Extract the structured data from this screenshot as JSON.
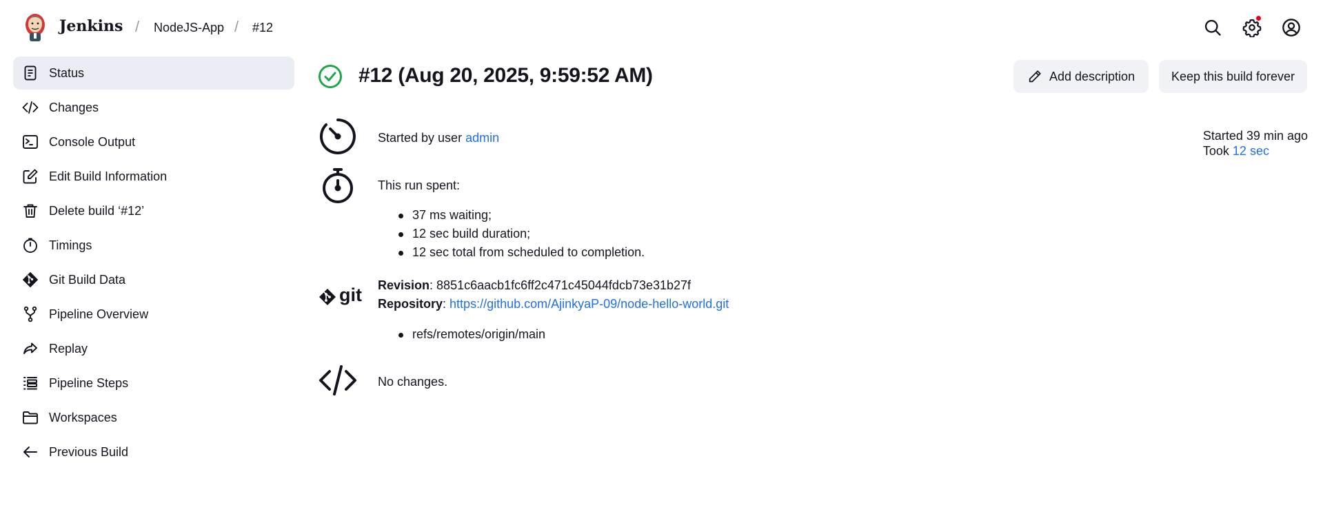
{
  "header": {
    "brand": "Jenkins",
    "breadcrumbs": [
      "NodeJS-App",
      "#12"
    ],
    "separator": "/",
    "icons": [
      "search-icon",
      "gear-icon",
      "user-icon"
    ],
    "notification_color": "#e6001f"
  },
  "sidebar": {
    "items": [
      {
        "label": "Status",
        "icon": "document-icon",
        "active": true
      },
      {
        "label": "Changes",
        "icon": "code-icon"
      },
      {
        "label": "Console Output",
        "icon": "terminal-icon"
      },
      {
        "label": "Edit Build Information",
        "icon": "edit-icon"
      },
      {
        "label": "Delete build ‘#12’",
        "icon": "trash-icon"
      },
      {
        "label": "Timings",
        "icon": "stopwatch-icon"
      },
      {
        "label": "Git Build Data",
        "icon": "git-icon"
      },
      {
        "label": "Pipeline Overview",
        "icon": "branch-icon"
      },
      {
        "label": "Replay",
        "icon": "replay-icon"
      },
      {
        "label": "Pipeline Steps",
        "icon": "list-icon"
      },
      {
        "label": "Workspaces",
        "icon": "folder-icon"
      },
      {
        "label": "Previous Build",
        "icon": "arrow-left-icon"
      }
    ]
  },
  "build": {
    "title": "#12 (Aug 20, 2025, 9:59:52 AM)",
    "status_color": "#1ea64b",
    "buttons": {
      "add_description": "Add description",
      "keep_forever": "Keep this build forever"
    },
    "started_by_prefix": "Started by user ",
    "started_by_user": "admin",
    "run_spent_label": "This run spent:",
    "run_spent": [
      "37 ms waiting;",
      "12 sec build duration;",
      "12 sec total from scheduled to completion."
    ],
    "revision_label": "Revision",
    "revision": "8851c6aacb1fc6ff2c471c45044fdcb73e31b27f",
    "repository_label": "Repository",
    "repository": "https://github.com/AjinkyaP-09/node-hello-world.git",
    "refs": [
      "refs/remotes/origin/main"
    ],
    "git_logo_text": "git",
    "changes_text": "No changes.",
    "started_ago": "Started 39 min ago",
    "took_prefix": "Took ",
    "took_value": "12 sec"
  },
  "colors": {
    "accent": "#1f6feb",
    "active_bg": "#eaedf3",
    "button_bg": "#f1f2f5"
  }
}
